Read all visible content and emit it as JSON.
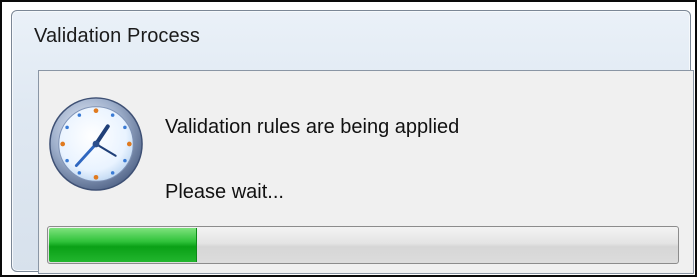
{
  "window": {
    "title": "Validation Process"
  },
  "icon": {
    "name": "clock-icon"
  },
  "messages": {
    "status": "Validation rules are being applied",
    "wait": "Please wait..."
  },
  "progress": {
    "fraction": 0.235,
    "fill_color": "#0aa016"
  },
  "colors": {
    "window_bg": "#dfe8f2",
    "client_bg": "#f0f0f0"
  }
}
